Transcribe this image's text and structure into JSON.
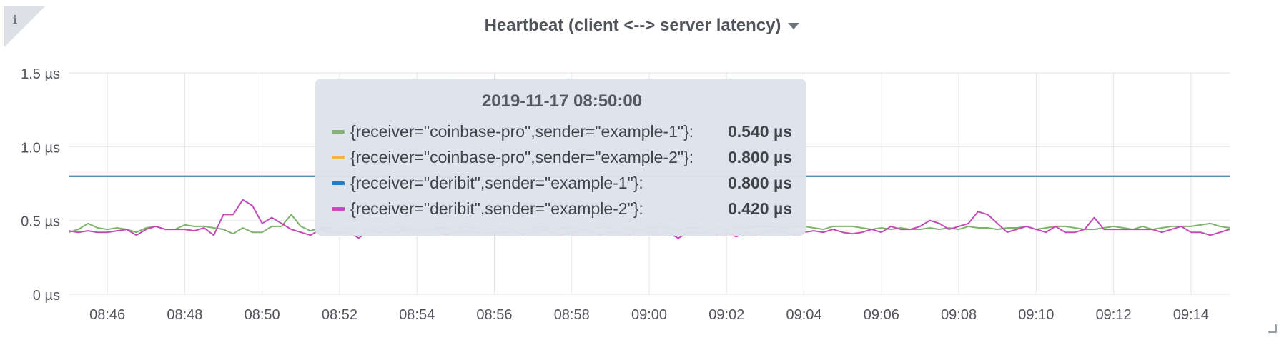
{
  "panel": {
    "title": "Heartbeat (client <--> server latency)",
    "info_glyph": "i"
  },
  "tooltip": {
    "time": "2019-11-17 08:50:00",
    "rows": [
      {
        "label": "{receiver=\"coinbase-pro\",sender=\"example-1\"}:",
        "value": "0.540 µs",
        "color": "#7eb26d"
      },
      {
        "label": "{receiver=\"coinbase-pro\",sender=\"example-2\"}:",
        "value": "0.800 µs",
        "color": "#eab839"
      },
      {
        "label": "{receiver=\"deribit\",sender=\"example-1\"}:",
        "value": "0.800 µs",
        "color": "#1f78c1"
      },
      {
        "label": "{receiver=\"deribit\",sender=\"example-2\"}:",
        "value": "0.420 µs",
        "color": "#c548b8"
      }
    ]
  },
  "chart_data": {
    "type": "line",
    "title": "Heartbeat (client <--> server latency)",
    "xlabel": "",
    "ylabel": "",
    "y_unit": "µs",
    "ylim": [
      0,
      1.5
    ],
    "y_ticks": [
      {
        "value": 0,
        "label": "0 µs"
      },
      {
        "value": 0.5,
        "label": "0.5 µs"
      },
      {
        "value": 1.0,
        "label": "1.0 µs"
      },
      {
        "value": 1.5,
        "label": "1.5 µs"
      }
    ],
    "x_range": [
      "08:45",
      "09:15"
    ],
    "x_ticks": [
      "08:46",
      "08:48",
      "08:50",
      "08:52",
      "08:54",
      "08:56",
      "08:58",
      "09:00",
      "09:02",
      "09:04",
      "09:06",
      "09:08",
      "09:10",
      "09:12",
      "09:14"
    ],
    "x_step_seconds": 15,
    "grid": true,
    "legend": "none",
    "series": [
      {
        "name": "{receiver=\"coinbase-pro\",sender=\"example-1\"}",
        "color": "#7eb26d",
        "values": [
          0.42,
          0.44,
          0.48,
          0.45,
          0.44,
          0.45,
          0.44,
          0.42,
          0.45,
          0.46,
          0.44,
          0.44,
          0.47,
          0.46,
          0.46,
          0.45,
          0.44,
          0.41,
          0.45,
          0.42,
          0.42,
          0.46,
          0.46,
          0.54,
          0.46,
          0.43,
          0.45,
          0.45,
          0.44,
          0.45,
          0.44,
          0.44,
          0.45,
          0.44,
          0.46,
          0.45,
          0.44,
          0.44,
          0.45,
          0.45,
          0.44,
          0.46,
          0.45,
          0.44,
          0.44,
          0.45,
          0.44,
          0.44,
          0.45,
          0.46,
          0.44,
          0.45,
          0.45,
          0.44,
          0.44,
          0.46,
          0.45,
          0.44,
          0.45,
          0.44,
          0.45,
          0.46,
          0.45,
          0.44,
          0.45,
          0.45,
          0.44,
          0.45,
          0.44,
          0.46,
          0.45,
          0.46,
          0.46,
          0.46,
          0.45,
          0.46,
          0.46,
          0.45,
          0.44,
          0.46,
          0.46,
          0.46,
          0.45,
          0.44,
          0.45,
          0.44,
          0.45,
          0.44,
          0.44,
          0.45,
          0.44,
          0.45,
          0.44,
          0.46,
          0.45,
          0.45,
          0.44,
          0.45,
          0.45,
          0.46,
          0.44,
          0.45,
          0.46,
          0.46,
          0.45,
          0.44,
          0.44,
          0.45,
          0.46,
          0.45,
          0.44,
          0.46,
          0.44,
          0.45,
          0.46,
          0.46,
          0.46,
          0.47,
          0.48,
          0.46,
          0.45
        ]
      },
      {
        "name": "{receiver=\"coinbase-pro\",sender=\"example-2\"}",
        "color": "#eab839",
        "values": [
          0.8,
          0.8,
          0.8,
          0.8,
          0.8,
          0.8,
          0.8,
          0.8,
          0.8,
          0.8,
          0.8,
          0.8,
          0.8,
          0.8,
          0.8,
          0.8,
          0.8,
          0.8,
          0.8,
          0.8,
          0.8,
          0.8,
          0.8,
          0.8,
          0.8,
          0.8,
          0.8,
          0.8,
          0.8,
          0.8,
          0.8,
          0.8,
          0.8,
          0.8,
          0.8,
          0.8,
          0.8,
          0.8,
          0.8,
          0.8,
          0.8,
          0.8,
          0.8,
          0.8,
          0.8,
          0.8,
          0.8,
          0.8,
          0.8,
          0.8,
          0.8,
          0.8,
          0.8,
          0.8,
          0.8,
          0.8,
          0.8,
          0.8,
          0.8,
          0.8,
          0.8,
          0.8,
          0.8,
          0.8,
          0.8,
          0.8,
          0.8,
          0.8,
          0.8,
          0.8,
          0.8,
          0.8,
          0.8,
          0.8,
          0.8,
          0.8,
          0.8,
          0.8,
          0.8,
          0.8,
          0.8,
          0.8,
          0.8,
          0.8,
          0.8,
          0.8,
          0.8,
          0.8,
          0.8,
          0.8,
          0.8,
          0.8,
          0.8,
          0.8,
          0.8,
          0.8,
          0.8,
          0.8,
          0.8,
          0.8,
          0.8,
          0.8,
          0.8,
          0.8,
          0.8,
          0.8,
          0.8,
          0.8,
          0.8,
          0.8,
          0.8,
          0.8,
          0.8,
          0.8,
          0.8,
          0.8,
          0.8,
          0.8,
          0.8,
          0.8,
          0.8
        ]
      },
      {
        "name": "{receiver=\"deribit\",sender=\"example-1\"}",
        "color": "#1f78c1",
        "values": [
          0.8,
          0.8,
          0.8,
          0.8,
          0.8,
          0.8,
          0.8,
          0.8,
          0.8,
          0.8,
          0.8,
          0.8,
          0.8,
          0.8,
          0.8,
          0.8,
          0.8,
          0.8,
          0.8,
          0.8,
          0.8,
          0.8,
          0.8,
          0.8,
          0.8,
          0.8,
          0.8,
          0.8,
          0.8,
          0.8,
          0.8,
          0.8,
          0.8,
          0.8,
          0.8,
          0.8,
          0.8,
          0.8,
          0.8,
          0.8,
          0.8,
          0.8,
          0.8,
          0.8,
          0.8,
          0.8,
          0.8,
          0.8,
          0.8,
          0.8,
          0.8,
          0.8,
          0.8,
          0.8,
          0.8,
          0.8,
          0.8,
          0.8,
          0.8,
          0.8,
          0.8,
          0.8,
          0.8,
          0.8,
          0.8,
          0.8,
          0.8,
          0.8,
          0.8,
          0.8,
          0.8,
          0.8,
          0.8,
          0.8,
          0.8,
          0.8,
          0.8,
          0.8,
          0.8,
          0.8,
          0.8,
          0.8,
          0.8,
          0.8,
          0.8,
          0.8,
          0.8,
          0.8,
          0.8,
          0.8,
          0.8,
          0.8,
          0.8,
          0.8,
          0.8,
          0.8,
          0.8,
          0.8,
          0.8,
          0.8,
          0.8,
          0.8,
          0.8,
          0.8,
          0.8,
          0.8,
          0.8,
          0.8,
          0.8,
          0.8,
          0.8,
          0.8,
          0.8,
          0.8,
          0.8,
          0.8,
          0.8,
          0.8,
          0.8,
          0.8,
          0.8
        ]
      },
      {
        "name": "{receiver=\"deribit\",sender=\"example-2\"}",
        "color": "#c548b8",
        "values": [
          0.43,
          0.42,
          0.43,
          0.42,
          0.42,
          0.43,
          0.44,
          0.4,
          0.44,
          0.46,
          0.44,
          0.44,
          0.44,
          0.43,
          0.45,
          0.4,
          0.54,
          0.54,
          0.64,
          0.6,
          0.48,
          0.52,
          0.48,
          0.44,
          0.42,
          0.4,
          0.44,
          0.42,
          0.42,
          0.42,
          0.38,
          0.44,
          0.42,
          0.43,
          0.42,
          0.44,
          0.42,
          0.43,
          0.44,
          0.4,
          0.42,
          0.43,
          0.42,
          0.41,
          0.42,
          0.42,
          0.43,
          0.4,
          0.42,
          0.44,
          0.42,
          0.4,
          0.42,
          0.43,
          0.42,
          0.4,
          0.42,
          0.42,
          0.4,
          0.44,
          0.42,
          0.4,
          0.42,
          0.38,
          0.42,
          0.41,
          0.42,
          0.4,
          0.42,
          0.39,
          0.42,
          0.4,
          0.42,
          0.44,
          0.42,
          0.4,
          0.42,
          0.43,
          0.42,
          0.44,
          0.42,
          0.41,
          0.42,
          0.44,
          0.42,
          0.46,
          0.44,
          0.44,
          0.46,
          0.5,
          0.48,
          0.44,
          0.46,
          0.48,
          0.56,
          0.54,
          0.48,
          0.42,
          0.44,
          0.46,
          0.44,
          0.42,
          0.46,
          0.42,
          0.42,
          0.44,
          0.52,
          0.44,
          0.44,
          0.44,
          0.44,
          0.44,
          0.44,
          0.42,
          0.44,
          0.46,
          0.42,
          0.42,
          0.4,
          0.42,
          0.44
        ]
      }
    ]
  }
}
